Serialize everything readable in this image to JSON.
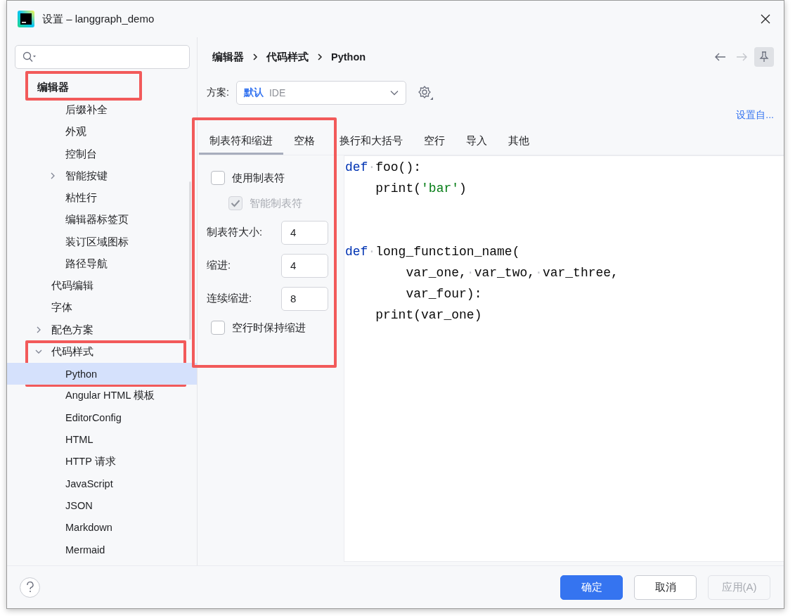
{
  "window": {
    "title": "设置 – langgraph_demo"
  },
  "sidebar": {
    "header": {
      "label": "编辑器",
      "highlighted": true
    },
    "items": [
      {
        "kind": "continued",
        "children": [
          {
            "label": "后缀补全",
            "selected": false
          },
          {
            "label": "外观",
            "selected": false
          },
          {
            "label": "控制台",
            "selected": false
          },
          {
            "label": "智能按键",
            "selected": false,
            "expanded": false
          },
          {
            "label": "粘性行",
            "selected": false
          },
          {
            "label": "编辑器标签页",
            "selected": false
          },
          {
            "label": "装订区域图标",
            "selected": false
          },
          {
            "label": "路径导航",
            "selected": false
          }
        ]
      },
      {
        "label": "代码编辑",
        "selected": false
      },
      {
        "label": "字体",
        "selected": false
      },
      {
        "label": "配色方案",
        "selected": false,
        "expanded": false
      },
      {
        "label": "代码样式",
        "selected": false,
        "expanded": true,
        "highlighted": true,
        "children": [
          {
            "label": "Python",
            "selected": true
          },
          {
            "label": "Angular HTML 模板",
            "selected": false
          },
          {
            "label": "EditorConfig",
            "selected": false
          },
          {
            "label": "HTML",
            "selected": false
          },
          {
            "label": "HTTP 请求",
            "selected": false
          },
          {
            "label": "JavaScript",
            "selected": false
          },
          {
            "label": "JSON",
            "selected": false
          },
          {
            "label": "Markdown",
            "selected": false
          },
          {
            "label": "Mermaid",
            "selected": false
          }
        ]
      }
    ]
  },
  "breadcrumb": [
    "编辑器",
    "代码样式",
    "Python"
  ],
  "scheme": {
    "label": "方案:",
    "name": "默认",
    "type": "IDE"
  },
  "set_from_link": "设置自...",
  "tabs": [
    {
      "label": "制表符和缩进",
      "selected": true
    },
    {
      "label": "空格",
      "selected": false
    },
    {
      "label": "换行和大括号",
      "selected": false
    },
    {
      "label": "空行",
      "selected": false
    },
    {
      "label": "导入",
      "selected": false
    },
    {
      "label": "其他",
      "selected": false
    }
  ],
  "options_panel": {
    "highlighted": true,
    "options": [
      {
        "kind": "checkbox",
        "label": "使用制表符",
        "checked": false,
        "disabled": false
      },
      {
        "kind": "checkbox",
        "label": "智能制表符",
        "checked": true,
        "disabled": true,
        "indented": true
      },
      {
        "kind": "number",
        "label": "制表符大小:",
        "value": "4"
      },
      {
        "kind": "number",
        "label": "缩进:",
        "value": "4"
      },
      {
        "kind": "number",
        "label": "连续缩进:",
        "value": "8"
      },
      {
        "kind": "checkbox",
        "label": "空行时保持缩进",
        "checked": false,
        "disabled": false
      }
    ]
  },
  "code_preview": [
    {
      "tokens": [
        {
          "kind": "keyword",
          "text": "def"
        },
        {
          "kind": "space",
          "text": "·"
        },
        {
          "kind": "plain",
          "text": "foo():"
        }
      ]
    },
    {
      "tokens": [
        {
          "kind": "plain",
          "text": "    print("
        },
        {
          "kind": "string",
          "text": "'bar'"
        },
        {
          "kind": "plain",
          "text": ")"
        }
      ]
    },
    {
      "kind": "blank"
    },
    {
      "kind": "blank"
    },
    {
      "tokens": [
        {
          "kind": "keyword",
          "text": "def"
        },
        {
          "kind": "space",
          "text": "·"
        },
        {
          "kind": "plain",
          "text": "long_function_name("
        }
      ]
    },
    {
      "tokens": [
        {
          "kind": "plain",
          "text": "        var_one,"
        },
        {
          "kind": "space",
          "text": "·"
        },
        {
          "kind": "plain",
          "text": "var_two,"
        },
        {
          "kind": "space",
          "text": "·"
        },
        {
          "kind": "plain",
          "text": "var_three,"
        }
      ]
    },
    {
      "tokens": [
        {
          "kind": "plain",
          "text": "        var_four):"
        }
      ]
    },
    {
      "tokens": [
        {
          "kind": "plain",
          "text": "    print(var_one)"
        }
      ]
    }
  ],
  "footer": {
    "buttons": [
      {
        "label": "确定",
        "kind": "primary",
        "disabled": false
      },
      {
        "label": "取消",
        "kind": "secondary",
        "disabled": false
      },
      {
        "label": "应用(A)",
        "kind": "secondary",
        "disabled": true
      }
    ]
  }
}
